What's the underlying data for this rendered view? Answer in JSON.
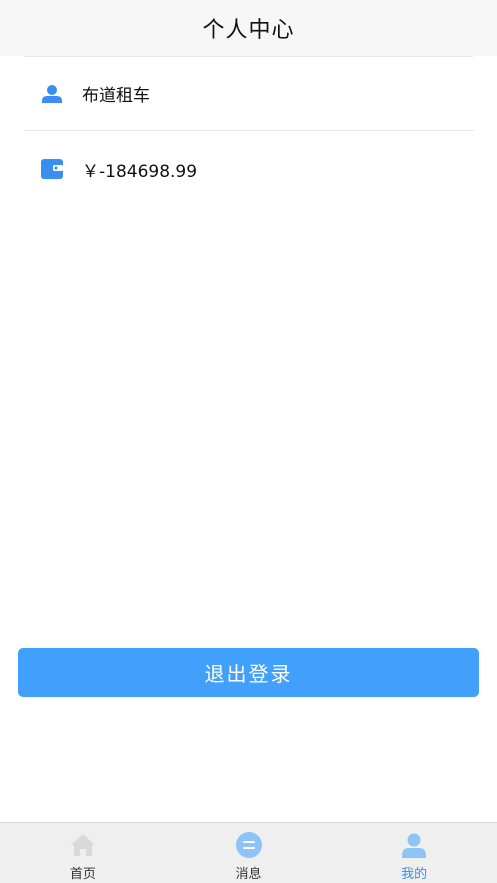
{
  "header": {
    "title": "个人中心"
  },
  "profile": {
    "username": "布道租车",
    "balance": "￥-184698.99"
  },
  "actions": {
    "logout_label": "退出登录"
  },
  "tabbar": {
    "items": [
      {
        "label": "首页",
        "icon": "home-icon",
        "active": false
      },
      {
        "label": "消息",
        "icon": "message-icon",
        "active": false
      },
      {
        "label": "我的",
        "icon": "user-icon",
        "active": true
      }
    ]
  },
  "colors": {
    "accent": "#40a0fb",
    "icon_blue": "#3a8ef0",
    "tab_inactive_icon": "#d9d9d9",
    "message_icon": "#8ec3f6",
    "active_user_icon": "#8ec3f6"
  }
}
